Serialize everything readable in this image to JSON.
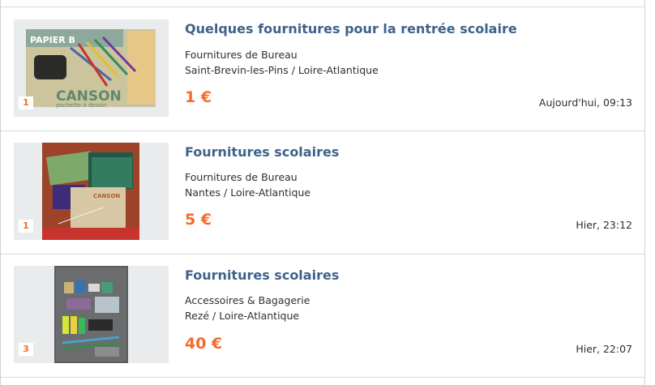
{
  "listings": [
    {
      "title": "Quelques fournitures pour la rentrée scolaire",
      "category": "Fournitures de Bureau",
      "location": "Saint-Brevin-les-Pins / Loire-Atlantique",
      "price": "1 €",
      "date": "Aujourd'hui, 09:13",
      "photo_count": "1",
      "image_text": "PAPIER B… / CANSON / pochette à dessin"
    },
    {
      "title": "Fournitures scolaires",
      "category": "Fournitures de Bureau",
      "location": "Nantes / Loire-Atlantique",
      "price": "5 €",
      "date": "Hier, 23:12",
      "photo_count": "1",
      "image_text": "CANSON"
    },
    {
      "title": "Fournitures scolaires",
      "category": "Accessoires & Bagagerie",
      "location": "Rezé / Loire-Atlantique",
      "price": "40 €",
      "date": "Hier, 22:07",
      "photo_count": "3"
    }
  ],
  "colors": {
    "title": "#3f628a",
    "price": "#f56b2a",
    "text": "#2d2f31",
    "thumb_bg": "#eaebec",
    "divider": "#d8dadc"
  },
  "icons": {
    "photo_count": "photo-count-badge"
  }
}
